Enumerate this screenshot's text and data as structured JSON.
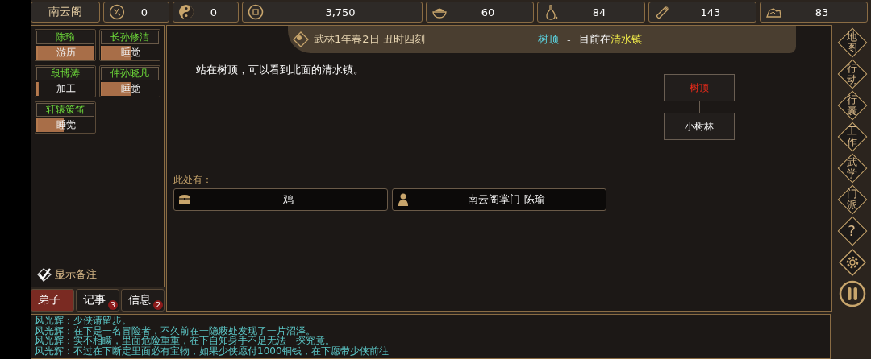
{
  "sect_name": "南云阁",
  "resources": [
    {
      "kind": "seal",
      "value": "0"
    },
    {
      "kind": "yinyang",
      "value": "0"
    },
    {
      "kind": "coin",
      "value": "3,750"
    },
    {
      "kind": "bowl",
      "value": "60"
    },
    {
      "kind": "gourd",
      "value": "84"
    },
    {
      "kind": "wood",
      "value": "143"
    },
    {
      "kind": "ore",
      "value": "83"
    }
  ],
  "disciples": [
    {
      "name": "陈瑜",
      "activity": "游历",
      "level": 1
    },
    {
      "name": "长孙修洁",
      "activity": "睡觉",
      "level": 0.5
    },
    {
      "name": "段博涛",
      "activity": "加工",
      "level": 0.02
    },
    {
      "name": "仲孙晓凡",
      "activity": "睡觉",
      "level": 0.5
    },
    {
      "name": "轩辕策笛",
      "activity": "睡觉",
      "level": 0.45
    }
  ],
  "show_notes": {
    "label": "显示备注",
    "checked": true
  },
  "tabs": [
    {
      "label": "弟子",
      "selected": true
    },
    {
      "label": "记事",
      "selected": false,
      "badge": "3"
    },
    {
      "label": "信息",
      "selected": false,
      "badge": "2"
    }
  ],
  "header": {
    "date": "武林1年春2日 丑时四刻",
    "location": "树顶",
    "separator": "-",
    "prefix": "目前在",
    "town": "清水镇"
  },
  "description": "站在树顶，可以看到北面的清水镇。",
  "map_nodes": [
    {
      "label": "树顶",
      "current": true
    },
    {
      "label": "小树林",
      "current": false
    }
  ],
  "here_label": "此处有：",
  "entities": [
    {
      "kind": "chest",
      "label": "鸡"
    },
    {
      "kind": "person",
      "label": "南云阁掌门 陈瑜"
    }
  ],
  "side_menu": [
    {
      "kind": "text",
      "label": "地图"
    },
    {
      "kind": "text",
      "label": "行动"
    },
    {
      "kind": "text",
      "label": "行囊"
    },
    {
      "kind": "text",
      "label": "工作"
    },
    {
      "kind": "text",
      "label": "武学"
    },
    {
      "kind": "text",
      "label": "门派"
    },
    {
      "kind": "text",
      "label": "?"
    },
    {
      "kind": "gear"
    },
    {
      "kind": "pause"
    }
  ],
  "log": [
    {
      "speaker": "风光辉：",
      "text": "少侠请留步。"
    },
    {
      "speaker": "风光辉：",
      "text": "在下是一名冒险者，不久前在一隐蔽处发现了一片沼泽。"
    },
    {
      "speaker": "风光辉：",
      "text": "实不相瞒，里面危险重重，在下自知身手不足无法一探究竟。"
    },
    {
      "speaker": "风光辉：",
      "text": "不过在下断定里面必有宝物，如果少侠愿付1000铜钱，在下愿带少侠前往"
    }
  ]
}
